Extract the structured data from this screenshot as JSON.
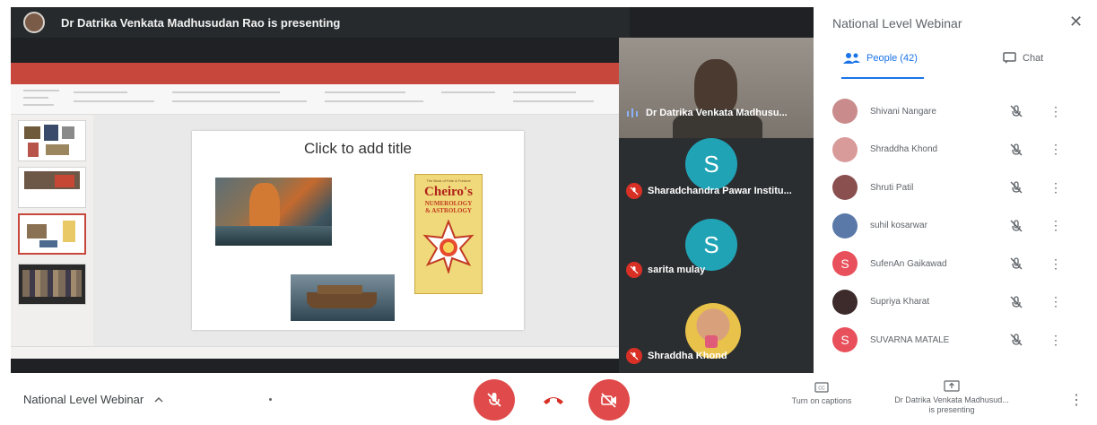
{
  "stage": {
    "presenting_text": "Dr Datrika Venkata Madhusudan Rao is presenting"
  },
  "slide": {
    "title_placeholder": "Click to add title",
    "book_name": "Cheiro's",
    "book_subtitle_1": "NUMEROLOGY",
    "book_subtitle_2": "& ASTROLOGY"
  },
  "tiles": [
    {
      "name": "Dr Datrika Venkata Madhusu...",
      "avatar_letter": "",
      "mic": "speaking"
    },
    {
      "name": "Sharadchandra Pawar Institu...",
      "avatar_letter": "S",
      "mic": "muted"
    },
    {
      "name": "sarita mulay",
      "avatar_letter": "S",
      "mic": "muted"
    },
    {
      "name": "Shraddha Khond",
      "avatar_letter": "",
      "mic": "muted"
    }
  ],
  "panel": {
    "title": "National Level Webinar",
    "tab_people": "People (42)",
    "tab_chat": "Chat",
    "participants": [
      {
        "name": "Shivani Nangare",
        "avatar_letter": "",
        "avatar_color": "#c98b8b"
      },
      {
        "name": "Shraddha Khond",
        "avatar_letter": "",
        "avatar_color": "#d99a9a"
      },
      {
        "name": "Shruti Patil",
        "avatar_letter": "",
        "avatar_color": "#8a4f4f"
      },
      {
        "name": "suhil kosarwar",
        "avatar_letter": "",
        "avatar_color": "#5a78a8"
      },
      {
        "name": "SufenAn Gaikawad",
        "avatar_letter": "S",
        "avatar_color": "#e8505b"
      },
      {
        "name": "Supriya Kharat",
        "avatar_letter": "",
        "avatar_color": "#3d2b2b"
      },
      {
        "name": "SUVARNA MATALE",
        "avatar_letter": "S",
        "avatar_color": "#e8505b"
      }
    ]
  },
  "bottom": {
    "meeting_name": "National Level Webinar",
    "captions_label": "Turn on captions",
    "present_line1": "Dr Datrika Venkata Madhusud...",
    "present_line2": "is presenting"
  },
  "colors": {
    "accent": "#1a73e8",
    "danger": "#e04a4a",
    "stage_bg": "#1f2124",
    "tile_avatar": "#21a3b6"
  }
}
